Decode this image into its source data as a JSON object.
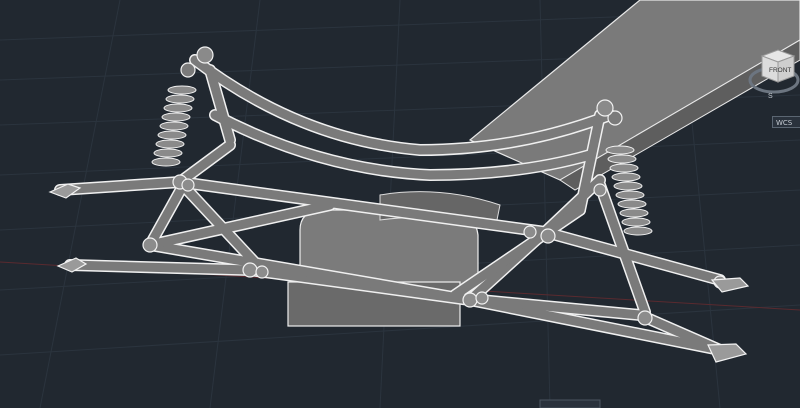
{
  "viewcube": {
    "face_label": "FRONT",
    "compass_south": "S"
  },
  "wcs": {
    "label": "WCS"
  },
  "colors": {
    "background": "#212830",
    "grid_line": "#2c3540",
    "axis_red": "#6b2a2a",
    "metal_fill": "#6e6e6e",
    "metal_highlight": "#bdbdbd",
    "edge": "#f2f2f2"
  }
}
